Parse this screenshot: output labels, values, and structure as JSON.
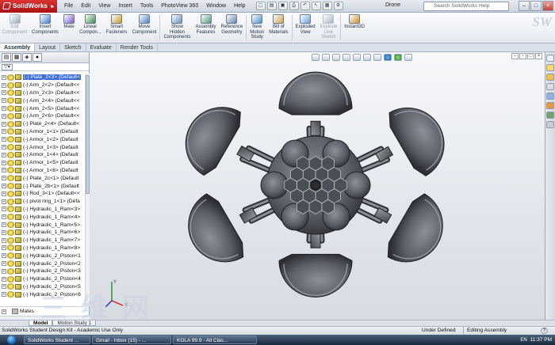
{
  "app": {
    "brand": "SolidWorks",
    "document_title": "Drone",
    "menus": [
      "File",
      "Edit",
      "View",
      "Insert",
      "Tools",
      "PhotoView 360",
      "Window",
      "Help"
    ],
    "search_placeholder": "Search SolidWorks Help",
    "watermark": "三维网"
  },
  "command_manager": {
    "tools": [
      {
        "label": "Edit\nComponent",
        "icon": "edit-component-icon",
        "enabled": false
      },
      {
        "label": "Insert\nComponents",
        "icon": "insert-components-icon",
        "enabled": true
      },
      {
        "label": "Mate",
        "icon": "mate-icon",
        "enabled": true
      },
      {
        "label": "Linear\nCompon...",
        "icon": "linear-pattern-icon",
        "enabled": true
      },
      {
        "label": "Smart\nFasteners",
        "icon": "smart-fasteners-icon",
        "enabled": true
      },
      {
        "label": "Move\nComponent",
        "icon": "move-component-icon",
        "enabled": true
      },
      {
        "label": "Show\nHidden\nComponents",
        "icon": "show-hidden-icon",
        "enabled": true
      },
      {
        "label": "Assembly\nFeatures",
        "icon": "assembly-features-icon",
        "enabled": true
      },
      {
        "label": "Reference\nGeometry",
        "icon": "reference-geometry-icon",
        "enabled": true
      },
      {
        "label": "New\nMotion\nStudy",
        "icon": "motion-study-icon",
        "enabled": true
      },
      {
        "label": "Bill of\nMaterials",
        "icon": "bom-icon",
        "enabled": true
      },
      {
        "label": "Exploded\nView",
        "icon": "exploded-view-icon",
        "enabled": true
      },
      {
        "label": "Explode\nLine\nSketch",
        "icon": "explode-line-icon",
        "enabled": false
      },
      {
        "label": "Instant3D",
        "icon": "instant3d-icon",
        "enabled": true
      }
    ],
    "tabs": [
      "Assembly",
      "Layout",
      "Sketch",
      "Evaluate",
      "Render Tools"
    ],
    "active_tab": "Assembly"
  },
  "feature_tree": {
    "items": [
      {
        "label": "(-) Plate_2<3> (Default<",
        "selected": true
      },
      {
        "label": "(-) Arm_2<2> (Default<<"
      },
      {
        "label": "(-) Arm_2<3> (Default<<"
      },
      {
        "label": "(-) Arm_2<4> (Default<<"
      },
      {
        "label": "(-) Arm_2<5> (Default<<"
      },
      {
        "label": "(-) Arm_2<6> (Default<<"
      },
      {
        "label": "(-) Plate_2<4> (Default<"
      },
      {
        "label": "(-) Armor_1<1> (Default"
      },
      {
        "label": "(-) Armor_1<2> (Default"
      },
      {
        "label": "(-) Armor_1<3> (Default"
      },
      {
        "label": "(-) Armor_1<4> (Default"
      },
      {
        "label": "(-) Armor_1<5> (Default"
      },
      {
        "label": "(-) Armor_1<6> (Default"
      },
      {
        "label": "(-) Plate_2c<1> (Default"
      },
      {
        "label": "(-) Plate_2b<1> (Default"
      },
      {
        "label": "(-) Rod_3<1> (Default<<"
      },
      {
        "label": "(-) pivot ring_1<1> (Defa"
      },
      {
        "label": "(-) Hydraulic_1_Ram<3>"
      },
      {
        "label": "(-) Hydraulic_1_Ram<4>"
      },
      {
        "label": "(-) Hydraulic_1_Ram<5>"
      },
      {
        "label": "(-) Hydraulic_1_Ram<6>"
      },
      {
        "label": "(-) Hydraulic_1_Ram<7>"
      },
      {
        "label": "(-) Hydraulic_1_Ram<8>"
      },
      {
        "label": "(-) Hydraulic_2_Piston<1"
      },
      {
        "label": "(-) Hydraulic_2_Piston<2"
      },
      {
        "label": "(-) Hydraulic_2_Piston<3"
      },
      {
        "label": "(-) Hydraulic_2_Piston<4"
      },
      {
        "label": "(-) Hydraulic_2_Piston<5"
      },
      {
        "label": "(-) Hydraulic_2_Piston<6"
      }
    ],
    "mates_label": "Mates"
  },
  "viewport": {
    "triad_labels": [
      "Y",
      "X",
      "Z"
    ]
  },
  "bottom_tabs": [
    "Model",
    "Motion Study 1"
  ],
  "status": {
    "left": "SolidWorks Student Design Kit - Academic Use Only",
    "state": "Under Defined",
    "mode": "Editing Assembly",
    "help": "?"
  },
  "taskbar": {
    "tasks": [
      "SolidWorks Student ...",
      "Gmail - Inbox (15) - ...",
      "KOLA 99.9 - All Clas..."
    ],
    "lang": "EN",
    "time": "11:37 PM"
  },
  "colors": {
    "selection": "#3b6cd6",
    "model_gray": "#5e6068",
    "model_dark": "#3a3c42",
    "brand_red": "#c12a2a"
  }
}
